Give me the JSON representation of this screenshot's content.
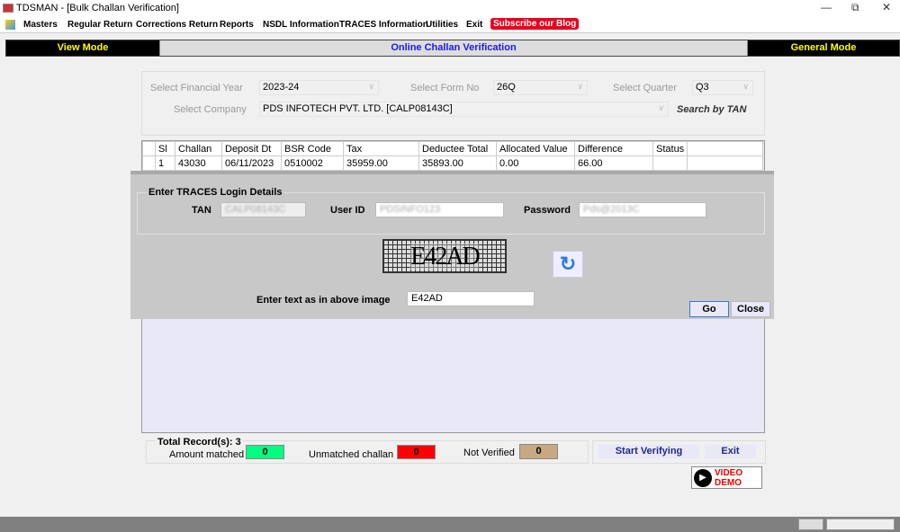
{
  "window": {
    "title": "TDSMAN - [Bulk Challan Verification]"
  },
  "menu": {
    "items": [
      "Masters",
      "Regular Return",
      "Corrections Return",
      "Reports",
      "NSDL Information",
      "TRACES Information",
      "Utilities",
      "Exit"
    ],
    "blog": "Subscribe our Blog"
  },
  "modes": {
    "view": "View Mode",
    "center": "Online Challan Verification",
    "general": "General Mode"
  },
  "filters": {
    "fy_label": "Select Financial Year",
    "fy_value": "2023-24",
    "form_label": "Select Form No",
    "form_value": "26Q",
    "quarter_label": "Select Quarter",
    "quarter_value": "Q3",
    "company_label": "Select Company",
    "company_value": "PDS INFOTECH PVT. LTD. [CALP08143C]",
    "search_tan": "Search by TAN"
  },
  "table": {
    "headers": [
      "Sl",
      "Challan",
      "Deposit Dt",
      "BSR Code",
      "Tax",
      "Deductee Total",
      "Allocated Value",
      "Difference",
      "Status"
    ],
    "rows": [
      [
        "1",
        "43030",
        "06/11/2023",
        "0510002",
        "35959.00",
        "35893.00",
        "0.00",
        "66.00",
        ""
      ]
    ]
  },
  "dialog": {
    "group_label": "Enter TRACES Login Details",
    "tan_label": "TAN",
    "tan_value": "CALP08143C",
    "userid_label": "User ID",
    "userid_value": "PDSINFO123",
    "password_label": "Password",
    "password_value": "Pds@2013C",
    "captcha_text": "E42AD",
    "captcha_label": "Enter text as in above image",
    "captcha_value": "E42AD",
    "go": "Go",
    "close": "Close"
  },
  "footer": {
    "total": "Total Record(s): 3",
    "matched_label": "Amount matched",
    "matched": "0",
    "unmatched_label": "Unmatched challan",
    "unmatched": "0",
    "notverified_label": "Not Verified",
    "notverified": "0",
    "start": "Start Verifying",
    "exit": "Exit",
    "video1": "VIDEO",
    "video2": "DEMO"
  },
  "colors": {
    "matched": "#00ff80",
    "unmatched": "#ff0000",
    "notverified": "#c8a882",
    "mode_text": "#ffff00",
    "center_text": "#1a1ae6"
  }
}
